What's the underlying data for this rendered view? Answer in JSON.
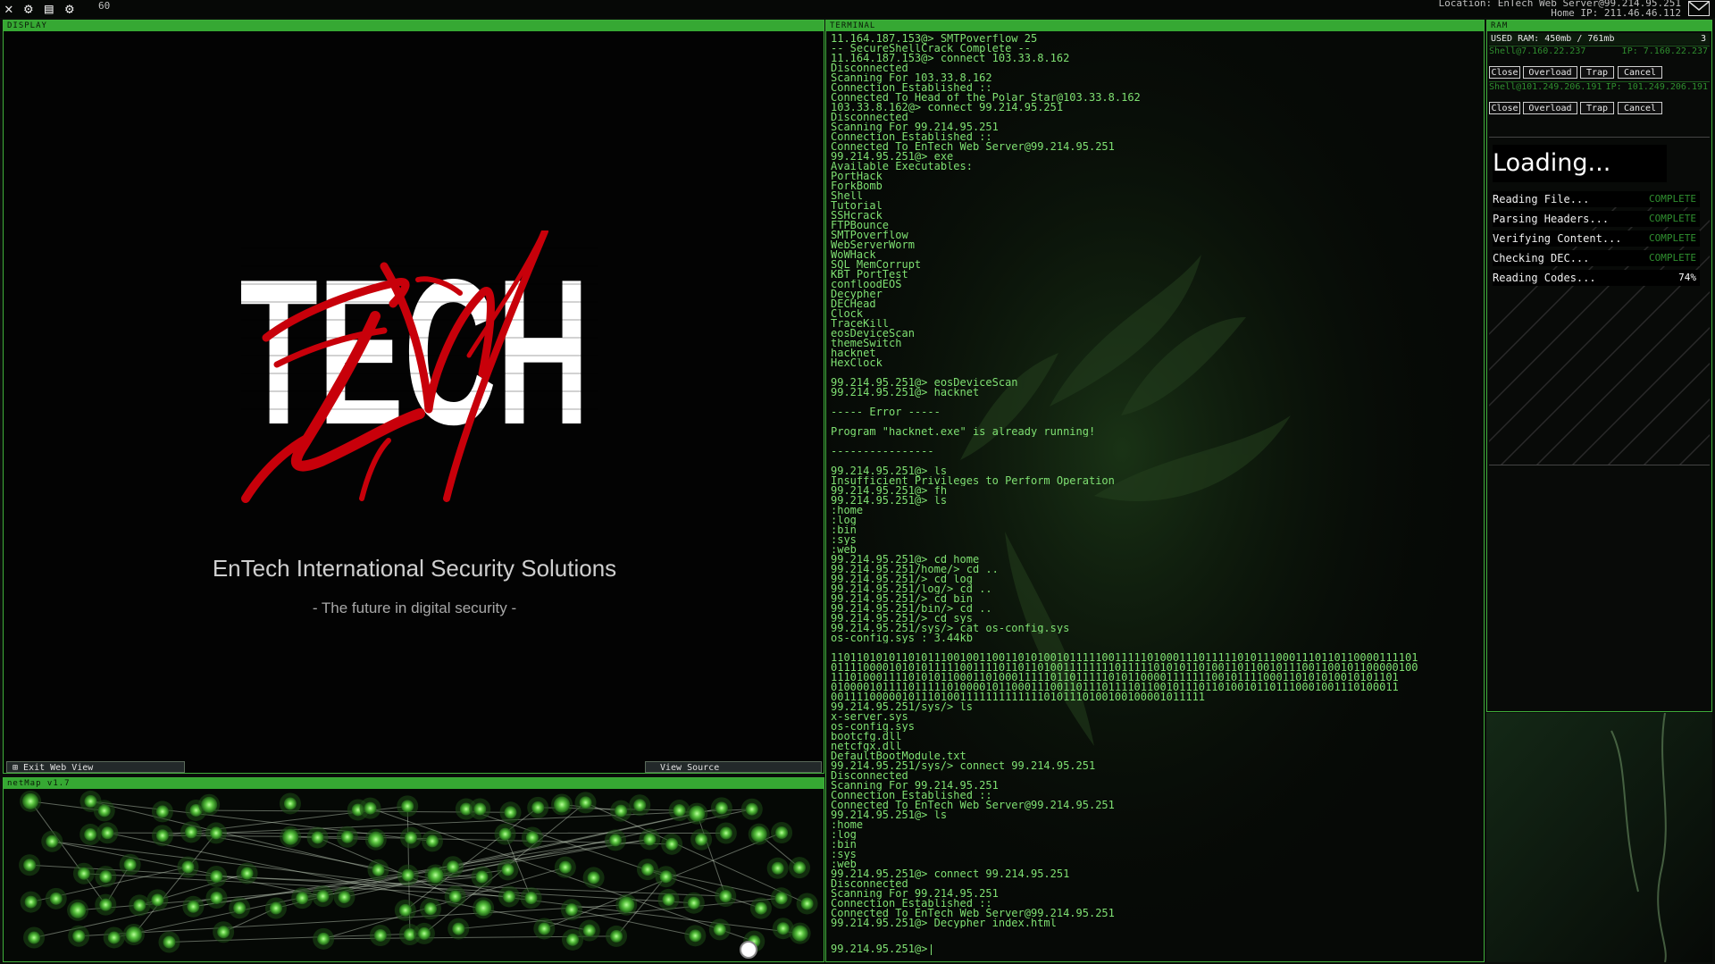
{
  "topbar": {
    "icons": [
      "close-icon",
      "gear-icon",
      "save-icon",
      "settings-icon"
    ],
    "fps": "60",
    "location": "Location: EnTech Web Server@99.214.95.251",
    "home_ip": "Home IP: 211.46.46.112"
  },
  "display": {
    "header": "DISPLAY",
    "logo_text": "TECH",
    "company": "EnTech International Security Solutions",
    "tagline": "- The future in digital security -",
    "exit_label": "Exit Web View",
    "source_label": "View Source"
  },
  "netmap": {
    "header": "netMap v1.7"
  },
  "terminal": {
    "header": "TERMINAL",
    "lines": [
      "11.164.187.153@> SMTPoverflow 25",
      "-- SecureShellCrack Complete --",
      "11.164.187.153@> connect 103.33.8.162",
      "Disconnected",
      "Scanning For 103.33.8.162",
      "Connection Established ::",
      "Connected To Head of the Polar Star@103.33.8.162",
      "103.33.8.162@> connect 99.214.95.251",
      "Disconnected",
      "Scanning For 99.214.95.251",
      "Connection Established ::",
      "Connected To EnTech Web Server@99.214.95.251",
      "99.214.95.251@> exe",
      "Available Executables:",
      "PortHack",
      "ForkBomb",
      "Shell",
      "Tutorial",
      "SSHcrack",
      "FTPBounce",
      "SMTPoverflow",
      "WebServerWorm",
      "WoWHack",
      "SQL_MemCorrupt",
      "KBT_PortTest",
      "confloodEOS",
      "Decypher",
      "DECHead",
      "Clock",
      "TraceKill",
      "eosDeviceScan",
      "themeSwitch",
      "hacknet",
      "HexClock",
      "",
      "99.214.95.251@> eosDeviceScan",
      "99.214.95.251@> hacknet",
      "",
      "----- Error -----",
      "",
      "Program \"hacknet.exe\" is already running!",
      "",
      "----------------",
      "",
      "99.214.95.251@> ls",
      "Insufficient Privileges to Perform Operation",
      "99.214.95.251@> fh",
      "99.214.95.251@> ls",
      ":home",
      ":log",
      ":bin",
      ":sys",
      ":web",
      "99.214.95.251@> cd home",
      "99.214.95.251/home/> cd ..",
      "99.214.95.251/> cd log",
      "99.214.95.251/log/> cd ..",
      "99.214.95.251/> cd bin",
      "99.214.95.251/bin/> cd ..",
      "99.214.95.251/> cd sys",
      "99.214.95.251/sys/> cat os-config.sys",
      "os-config.sys : 3.44kb",
      "",
      "1101101010110101110010011001101010010111110011111010001110111110101110001110110110000111101",
      "0111100001010101111100111101101101001111111101111101010110100110110010111001100101100000100",
      "1110100011110101011000110100011111011011111010110000111111100101111000110101010010101101",
      "0100001011110111110100001011000111001101110111101100101110110100101101110001001110100011",
      "0011110000010111010011111111111110101110100100100001011111",
      "99.214.95.251/sys/> ls",
      "x-server.sys",
      "os-config.sys",
      "bootcfg.dll",
      "netcfgx.dll",
      "DefaultBootModule.txt",
      "99.214.95.251/sys/> connect 99.214.95.251",
      "Disconnected",
      "Scanning For 99.214.95.251",
      "Connection Established ::",
      "Connected To EnTech Web Server@99.214.95.251",
      "99.214.95.251@> ls",
      ":home",
      ":log",
      ":bin",
      ":sys",
      ":web",
      "99.214.95.251@> connect 99.214.95.251",
      "Disconnected",
      "Scanning For 99.214.95.251",
      "Connection Established ::",
      "Connected To EnTech Web Server@99.214.95.251",
      "99.214.95.251@> Decypher index.html"
    ],
    "prompt": "99.214.95.251@>"
  },
  "ram": {
    "header": "RAM",
    "used": "USED RAM: 450mb / 761mb",
    "count": "3",
    "shells": [
      {
        "label": "Shell@7.160.22.237",
        "ip": "IP: 7.160.22.237"
      },
      {
        "label": "Shell@101.249.206.191",
        "ip": "IP: 101.249.206.191"
      }
    ],
    "buttons": {
      "close": "Close",
      "overload": "Overload",
      "trap": "Trap",
      "cancel": "Cancel"
    },
    "loading": {
      "title": "Loading...",
      "steps": [
        {
          "label": "Reading File...",
          "status": "COMPLETE"
        },
        {
          "label": "Parsing Headers...",
          "status": "COMPLETE"
        },
        {
          "label": "Verifying Content...",
          "status": "COMPLETE"
        },
        {
          "label": "Checking DEC...",
          "status": "COMPLETE"
        },
        {
          "label": "Reading Codes...",
          "status": "74%"
        }
      ]
    }
  },
  "colors": {
    "accent": "#36a833",
    "text": "#7fe072",
    "logo_red": "#c8000a"
  }
}
